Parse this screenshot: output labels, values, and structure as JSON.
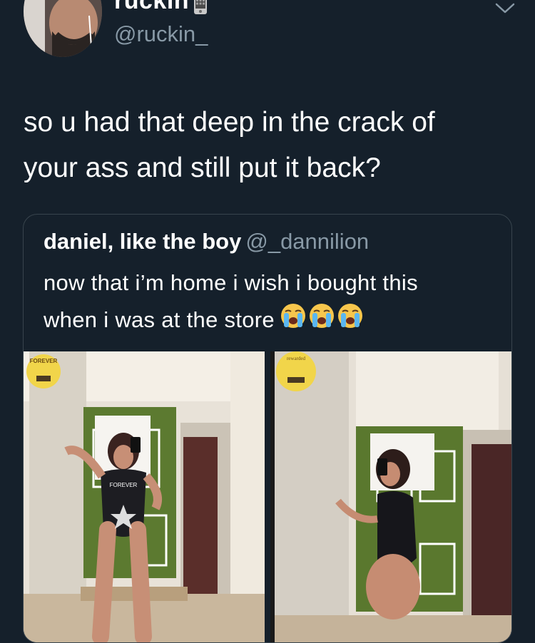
{
  "tweet": {
    "display_name": "ruckin",
    "handle": "@ruckin_",
    "text_line1": "so u had that deep in the crack of",
    "text_line2": "your ass and still put it back?"
  },
  "quoted_tweet": {
    "display_name": "daniel, like the boy",
    "handle": "@_dannilion",
    "text_line1": "now that i’m home i wish i bought this",
    "text_line2": "when i was at the store",
    "emojis": [
      "loudly-crying-face",
      "loudly-crying-face",
      "loudly-crying-face"
    ]
  },
  "media": {
    "left_sign": "FOREVER",
    "right_sign": "rewarded",
    "swimsuit_text": "FOREVER"
  },
  "icons": {
    "name_badge": "phone-emoji",
    "menu": "chevron-down-icon"
  },
  "colors": {
    "background": "#15202b",
    "secondary_text": "#8899a6",
    "border": "#38444d"
  }
}
